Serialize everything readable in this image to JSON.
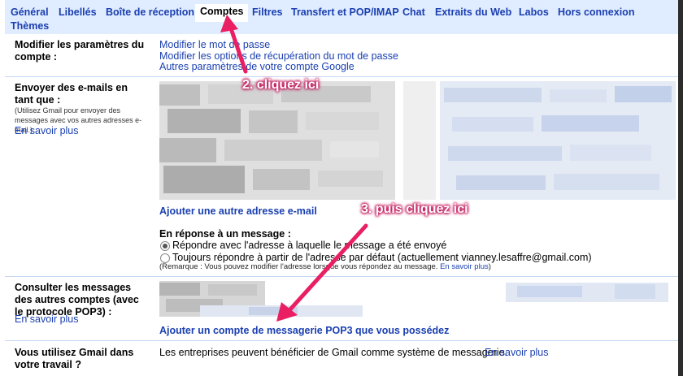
{
  "tabs": [
    "Général",
    "Libellés",
    "Boîte de réception",
    "Comptes",
    "Filtres",
    "Transfert et POP/IMAP",
    "Chat",
    "Extraits du Web",
    "Labos",
    "Hors connexion"
  ],
  "tab_second_line": "Thèmes",
  "active_tab": "Comptes",
  "sections": {
    "modifier": {
      "label": "Modifier les paramètres du compte :",
      "links": [
        "Modifier le mot de passe",
        "Modifier les options de récupération du mot de passe",
        "Autres paramètres de votre compte Google"
      ]
    },
    "envoyer": {
      "label": "Envoyer des e-mails en tant que :",
      "help": "(Utilisez Gmail pour envoyer des messages avec vos autres adresses e-mail.)",
      "learn_more": "En savoir plus",
      "add_address": "Ajouter une autre adresse e-mail",
      "reply_heading": "En réponse à un message :",
      "reply_option_1": "Répondre avec l'adresse à laquelle le message a été envoyé",
      "reply_option_2": "Toujours répondre à partir de l'adresse par défaut (actuellement vianney.lesaffre@gmail.com)",
      "remark": "(Remarque : Vous pouvez modifier l'adresse lorsque vous répondez au message.",
      "remark_link": "En savoir plus",
      "remark_end": ")"
    },
    "consulter": {
      "label": "Consulter les messages des autres comptes (avec le protocole POP3) :",
      "learn_more": "En savoir plus",
      "add_pop3": "Ajouter un compte de messagerie POP3 que vous possédez"
    },
    "travail": {
      "label": "Vous utilisez Gmail dans votre travail ?",
      "text": "Les entreprises peuvent bénéficier de Gmail comme système de messagerie.",
      "learn_more": "En savoir plus"
    }
  },
  "annotations": {
    "step2": "2. cliquez ici",
    "step3": "3. puis cliquez ici",
    "color": "#e91e63"
  }
}
